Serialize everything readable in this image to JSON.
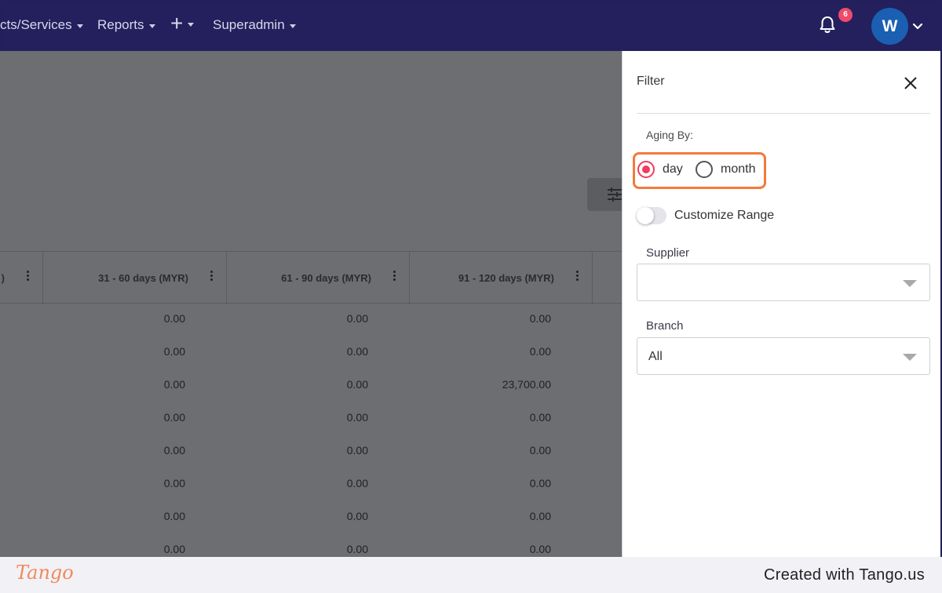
{
  "nav": {
    "items": [
      {
        "label": "cts/Services"
      },
      {
        "label": "Reports"
      },
      {
        "label": "+"
      },
      {
        "label": "Superadmin"
      }
    ],
    "notification_count": "6",
    "avatar_initial": "W"
  },
  "table": {
    "columns": [
      {
        "label": ")"
      },
      {
        "label": "31 - 60 days (MYR)"
      },
      {
        "label": "61 - 90 days (MYR)"
      },
      {
        "label": "91 - 120 days (MYR)"
      }
    ],
    "rows": [
      [
        "0.00",
        "0.00",
        "0.00"
      ],
      [
        "0.00",
        "0.00",
        "0.00"
      ],
      [
        "0.00",
        "0.00",
        "23,700.00"
      ],
      [
        "0.00",
        "0.00",
        "0.00"
      ],
      [
        "0.00",
        "0.00",
        "0.00"
      ],
      [
        "0.00",
        "0.00",
        "0.00"
      ],
      [
        "0.00",
        "0.00",
        "0.00"
      ],
      [
        "0.00",
        "0.00",
        "0.00"
      ]
    ]
  },
  "filter": {
    "title": "Filter",
    "aging_label": "Aging By:",
    "options": [
      {
        "label": "day",
        "selected": true
      },
      {
        "label": "month",
        "selected": false
      }
    ],
    "customize_range_label": "Customize Range",
    "customize_range_on": false,
    "supplier_label": "Supplier",
    "supplier_value": "",
    "branch_label": "Branch",
    "branch_value": "All"
  },
  "footer": {
    "logo_text": "Tango",
    "created_text": "Created with Tango.us"
  },
  "colors": {
    "nav_bg": "#23205d",
    "radio_selected": "#ef3d5c",
    "highlight": "#f47a3a",
    "badge": "#ef4a6a",
    "avatar": "#1b5fb3"
  }
}
